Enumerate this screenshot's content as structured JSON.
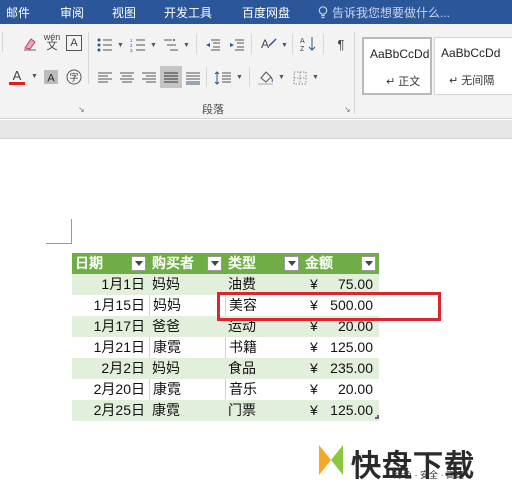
{
  "tabs": [
    "邮件",
    "审阅",
    "视图",
    "开发工具",
    "百度网盘"
  ],
  "tell_me": "告诉我您想要做什么...",
  "ribbon": {
    "group_label": "段落",
    "font_color": "#e31c1c",
    "styles": [
      {
        "sample": "AaBbCcDd",
        "name": "↵ 正文"
      },
      {
        "sample": "AaBbCcDd",
        "name": "↵ 无间隔"
      }
    ]
  },
  "table": {
    "headers": [
      "日期",
      "购买者",
      "类型",
      "金额"
    ],
    "rows": [
      {
        "date": "1月1日",
        "buyer": "妈妈",
        "type": "油费",
        "currency": "¥",
        "amount": "75.00"
      },
      {
        "date": "1月15日",
        "buyer": "妈妈",
        "type": "美容",
        "currency": "¥",
        "amount": "500.00"
      },
      {
        "date": "1月17日",
        "buyer": "爸爸",
        "type": "运动",
        "currency": "¥",
        "amount": "20.00"
      },
      {
        "date": "1月21日",
        "buyer": "康霓",
        "type": "书籍",
        "currency": "¥",
        "amount": "125.00"
      },
      {
        "date": "2月2日",
        "buyer": "妈妈",
        "type": "食品",
        "currency": "¥",
        "amount": "235.00"
      },
      {
        "date": "2月20日",
        "buyer": "康霓",
        "type": "音乐",
        "currency": "¥",
        "amount": "20.00"
      },
      {
        "date": "2月25日",
        "buyer": "康霓",
        "type": "门票",
        "currency": "¥",
        "amount": "125.00"
      }
    ],
    "header_color": "#70ad47",
    "band_color": "#e2efda"
  },
  "highlight_color": "#d9262f",
  "watermark": {
    "title": "快盘下载",
    "subtitle": "绿色 · 安全 · 高速"
  }
}
